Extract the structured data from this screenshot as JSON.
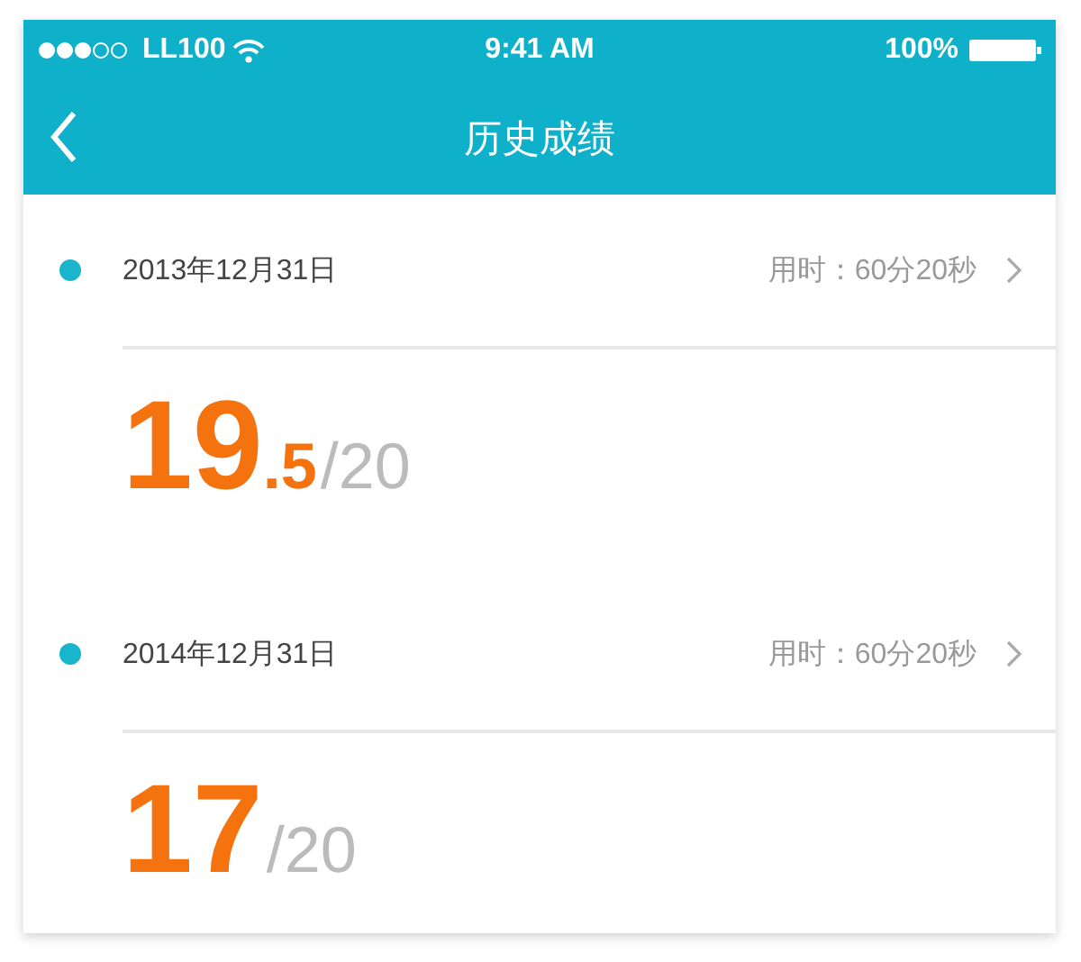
{
  "status_bar": {
    "carrier": "LL100",
    "time": "9:41 AM",
    "battery": "100%"
  },
  "nav": {
    "title": "历史成绩"
  },
  "records": [
    {
      "date": "2013年12月31日",
      "duration": "用时：60分20秒",
      "score": "19",
      "decimal": ".5",
      "total": "/20",
      "color": "#19b5cc"
    },
    {
      "date": "2014年12月31日",
      "duration": "用时：60分20秒",
      "score": "17",
      "total": "/20",
      "color": "#19b5cc"
    }
  ]
}
